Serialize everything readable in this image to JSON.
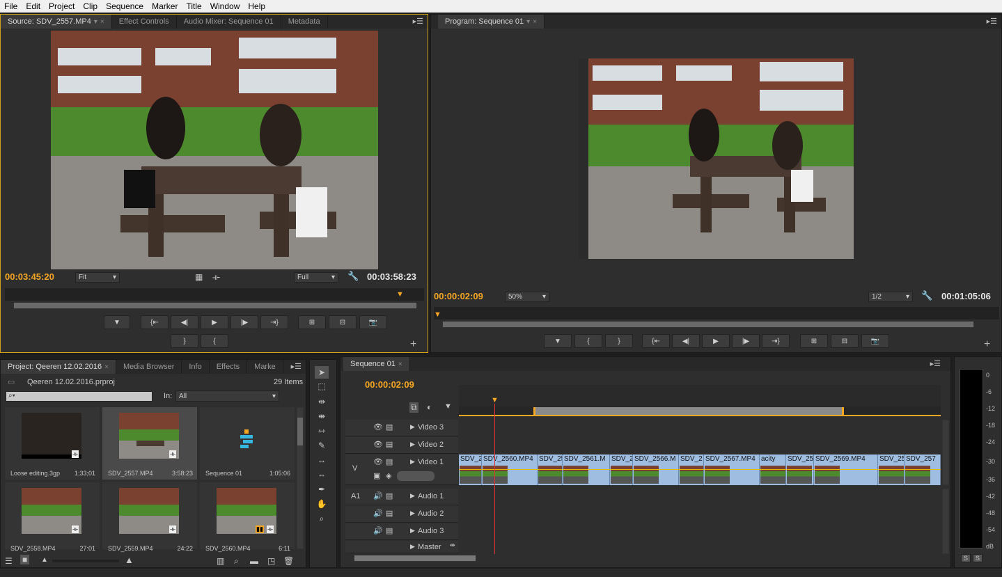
{
  "menu": [
    "File",
    "Edit",
    "Project",
    "Clip",
    "Sequence",
    "Marker",
    "Title",
    "Window",
    "Help"
  ],
  "source_panel": {
    "tabs": [
      {
        "label": "Source: SDV_2557.MP4",
        "active": true
      },
      {
        "label": "Effect Controls"
      },
      {
        "label": "Audio Mixer: Sequence 01"
      },
      {
        "label": "Metadata"
      }
    ],
    "timecode_in": "00:03:45:20",
    "timecode_out": "00:03:58:23",
    "zoom": "Fit",
    "quality": "Full"
  },
  "program_panel": {
    "tab": "Program: Sequence 01",
    "timecode_in": "00:00:02:09",
    "timecode_out": "00:01:05:06",
    "zoom": "50%",
    "quality": "1/2"
  },
  "project_panel": {
    "tabs": [
      "Project: Qeeren 12.02.2016",
      "Media Browser",
      "Info",
      "Effects",
      "Marke"
    ],
    "file": "Qeeren 12.02.2016.prproj",
    "items_count": "29 Items",
    "search_placeholder": "",
    "in_label": "In:",
    "in_value": "All",
    "items": [
      {
        "name": "Loose editing.3gp",
        "duration": "1;33;01"
      },
      {
        "name": "SDV_2557.MP4",
        "duration": "3:58:23"
      },
      {
        "name": "Sequence 01",
        "duration": "1:05:06"
      },
      {
        "name": "SDV_2558.MP4",
        "duration": "27:01"
      },
      {
        "name": "SDV_2559.MP4",
        "duration": "24:22"
      },
      {
        "name": "SDV_2560.MP4",
        "duration": "6:11"
      }
    ]
  },
  "timeline": {
    "tab": "Sequence 01",
    "timecode": "00:00:02:09",
    "video_tracks": [
      "Video 3",
      "Video 2",
      "Video 1"
    ],
    "audio_tracks": [
      "Audio 1",
      "Audio 2",
      "Audio 3"
    ],
    "master": "Master",
    "v_label": "V",
    "a_label": "A1",
    "clips": [
      "SDV_2",
      "SDV_2560.MP4",
      "SDV_25",
      "SDV_2561.M",
      "SDV_2",
      "SDV_2566.M",
      "SDV_2",
      "SDV_2567.MP4",
      "acity",
      "SDV_25",
      "SDV_2569.MP4",
      "SDV_25",
      "SDV_257"
    ]
  },
  "meter": {
    "labels": [
      "0",
      "-6",
      "-12",
      "-18",
      "-24",
      "-30",
      "-36",
      "-42",
      "-48",
      "-54",
      "dB"
    ],
    "solo": [
      "S",
      "S"
    ]
  }
}
